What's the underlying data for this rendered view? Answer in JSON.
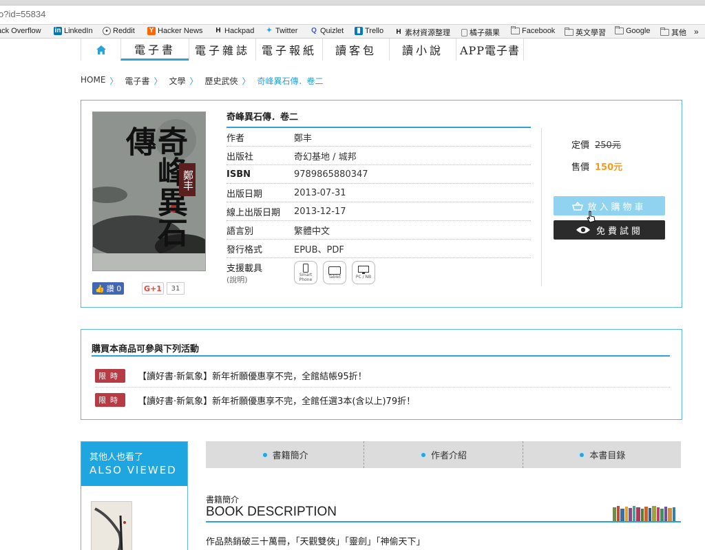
{
  "browser": {
    "url": "o?id=55834",
    "bookmarks": [
      {
        "label": "ack Overflow",
        "icon": "none"
      },
      {
        "label": "LinkedIn",
        "icon": "linkedin-icon"
      },
      {
        "label": "Reddit",
        "icon": "reddit-icon"
      },
      {
        "label": "Hacker News",
        "icon": "hackernews-icon"
      },
      {
        "label": "Hackpad",
        "icon": "hackpad-icon"
      },
      {
        "label": "Twitter",
        "icon": "twitter-icon"
      },
      {
        "label": "Quizlet",
        "icon": "quizlet-icon"
      },
      {
        "label": "Trello",
        "icon": "trello-icon"
      },
      {
        "label": "素材資源整理",
        "icon": "hackpad-icon"
      },
      {
        "label": "橘子蘋果",
        "icon": "page-icon"
      },
      {
        "label": "Facebook",
        "icon": "folder-icon"
      },
      {
        "label": "英文學習",
        "icon": "folder-icon"
      },
      {
        "label": "Google",
        "icon": "folder-icon"
      },
      {
        "label": "其他",
        "icon": "folder-icon"
      }
    ]
  },
  "nav": {
    "items": [
      "電子書",
      "電子雜誌",
      "電子報紙",
      "讀客包",
      "讀小說",
      "APP電子書"
    ]
  },
  "breadcrumb": [
    "HOME",
    "電子書",
    "文學",
    "歷史武俠",
    "奇峰異石傳．卷二"
  ],
  "book": {
    "title": "奇峰異石傳．卷二",
    "cover_title": "奇峰異石傳",
    "cover_author": "鄭丰",
    "details": [
      {
        "label": "作者",
        "value": "鄭丰"
      },
      {
        "label": "出版社",
        "value": "奇幻基地 / 城邦"
      },
      {
        "label": "ISBN",
        "value": "9789865880347"
      },
      {
        "label": "出版日期",
        "value": "2013-07-31"
      },
      {
        "label": "線上出版日期",
        "value": "2013-12-17"
      },
      {
        "label": "語言別",
        "value": "繁體中文"
      },
      {
        "label": "發行格式",
        "value": "EPUB、PDF"
      }
    ],
    "support_label": "支援載具",
    "support_note": "(說明)",
    "devices": [
      "Smart Phone",
      "Tablet",
      "PC / NB"
    ]
  },
  "social": {
    "fb_label": "讚 0",
    "gplus_label": "G+1",
    "gplus_count": "31"
  },
  "price": {
    "list_label": "定價",
    "list_value": "250元",
    "sale_label": "售價",
    "sale_value": "150元"
  },
  "buttons": {
    "cart": "放入購物車",
    "trial": "免費試閱"
  },
  "promo": {
    "title": "購買本商品可參與下列活動",
    "tag": "限時",
    "items": [
      "【讀好書‧新氣象】新年祈願優惠享不完，全館結帳95折！",
      "【讀好書‧新氣象】新年祈願優惠享不完，全館任選3本(含以上)79折！"
    ]
  },
  "also_viewed": {
    "zh": "其他人也看了",
    "en": "ALSO VIEWED"
  },
  "tabs": [
    "書籍簡介",
    "作者介紹",
    "本書目錄"
  ],
  "description": {
    "sub": "書籍簡介",
    "head": "BOOK DESCRIPTION",
    "text": "作品熱銷破三十萬冊，「天觀雙俠」「靈劍」「神偷天下」"
  },
  "colors": {
    "accent": "#29a3d8",
    "sale": "#f59c1a",
    "tag": "#b73b45",
    "cart": "#8fd3f1",
    "trial": "#2b2b2b"
  }
}
